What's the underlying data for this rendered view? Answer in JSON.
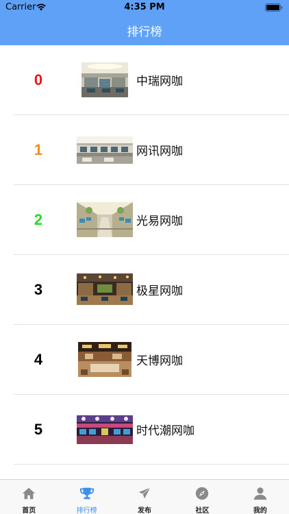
{
  "status_bar": {
    "carrier": "Carrier",
    "time": "4:35 PM",
    "icons": [
      "wifi-icon",
      "battery-icon"
    ]
  },
  "nav": {
    "title": "排行榜"
  },
  "ranking": [
    {
      "rank": "0",
      "name": "中瑞网咖",
      "rank_color": "#e8141a"
    },
    {
      "rank": "1",
      "name": "网讯网咖",
      "rank_color": "#f28c1c"
    },
    {
      "rank": "2",
      "name": "光易网咖",
      "rank_color": "#1fe01f"
    },
    {
      "rank": "3",
      "name": "极星网咖",
      "rank_color": "#000000"
    },
    {
      "rank": "4",
      "name": "天博网咖",
      "rank_color": "#000000"
    },
    {
      "rank": "5",
      "name": "时代潮网咖",
      "rank_color": "#000000"
    }
  ],
  "tab_bar": {
    "active_color": "#3d8ff0",
    "tabs": [
      {
        "label": "首页",
        "icon": "home-icon"
      },
      {
        "label": "排行榜",
        "icon": "trophy-icon",
        "active": true
      },
      {
        "label": "发布",
        "icon": "send-icon"
      },
      {
        "label": "社区",
        "icon": "compass-icon"
      },
      {
        "label": "我的",
        "icon": "user-icon"
      }
    ]
  }
}
